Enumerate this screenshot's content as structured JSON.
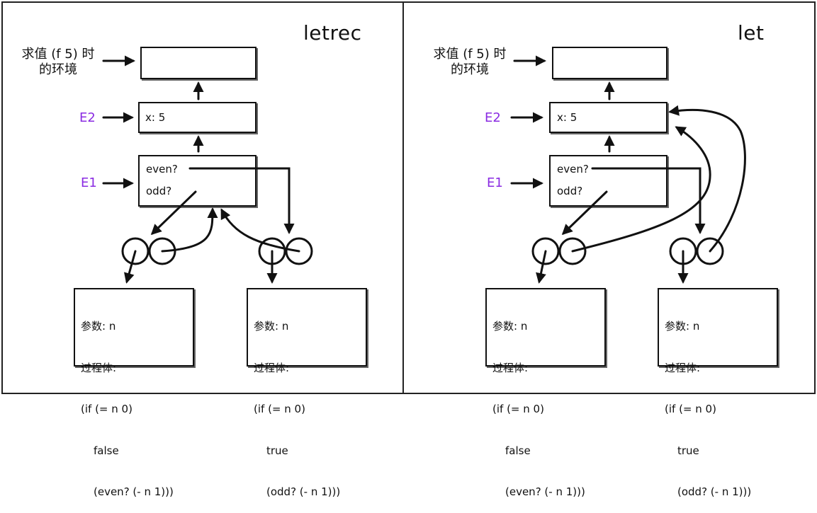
{
  "left": {
    "title": "letrec",
    "env_label_line1": "求值 (f 5) 时",
    "env_label_line2": "的环境",
    "e2_tag": "E2",
    "e1_tag": "E1",
    "e2_binding": "x: 5",
    "e1_even": "even?",
    "e1_odd": "odd?",
    "proc_even": {
      "params": "参数: n",
      "body_label": "过程体:",
      "l1": "(if (= n 0)",
      "l2": "false",
      "l3": "(even? (- n 1)))"
    },
    "proc_odd": {
      "params": "参数: n",
      "body_label": "过程体:",
      "l1": "(if (= n 0)",
      "l2": "true",
      "l3": "(odd? (- n 1)))"
    }
  },
  "right": {
    "title": "let",
    "env_label_line1": "求值 (f 5) 时",
    "env_label_line2": "的环境",
    "e2_tag": "E2",
    "e1_tag": "E1",
    "e2_binding": "x: 5",
    "e1_even": "even?",
    "e1_odd": "odd?",
    "proc_even": {
      "params": "参数: n",
      "body_label": "过程体:",
      "l1": "(if (= n 0)",
      "l2": "false",
      "l3": "(even? (- n 1)))"
    },
    "proc_odd": {
      "params": "参数: n",
      "body_label": "过程体:",
      "l1": "(if (= n 0)",
      "l2": "true",
      "l3": "(odd? (- n 1)))"
    }
  },
  "colors": {
    "env_tag": "#8a2be2",
    "line": "#111111"
  }
}
